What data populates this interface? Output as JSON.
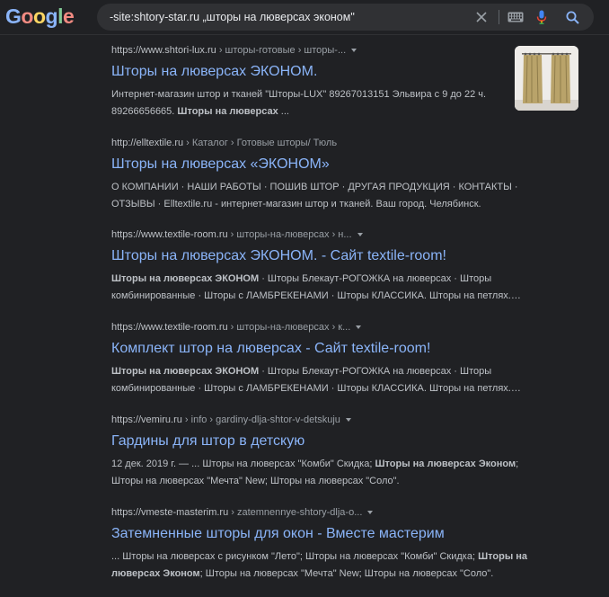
{
  "header": {
    "logo_letters": [
      {
        "ch": "G",
        "color": "#8ab4f8"
      },
      {
        "ch": "o",
        "color": "#f28b82"
      },
      {
        "ch": "o",
        "color": "#fdd663"
      },
      {
        "ch": "g",
        "color": "#8ab4f8"
      },
      {
        "ch": "l",
        "color": "#81c995"
      },
      {
        "ch": "e",
        "color": "#f28b82"
      }
    ],
    "search_query": "-site:shtory-star.ru „шторы на люверсах эконом\""
  },
  "results": [
    {
      "url": "https://www.shtori-lux.ru",
      "crumbs": " › шторы-готовые › шторы-...",
      "title": "Шторы на люверсах ЭКОНОМ.",
      "snippet_parts": [
        {
          "t": "Интернет-магазин штор и тканей \"Шторы-LUX\" 89267013151 Эльвира с 9 до 22 ч. 89266656665. ",
          "b": false
        },
        {
          "t": "Шторы на люверсах",
          "b": true
        },
        {
          "t": " ...",
          "b": false
        }
      ]
    },
    {
      "url": "http://elltextile.ru",
      "crumbs": " › Каталог › Готовые шторы/ Тюль",
      "title": "Шторы на люверсах «ЭКОНОМ»",
      "snippet_parts": [
        {
          "t": "О КОМПАНИИ · НАШИ РАБОТЫ · ПОШИВ ШТОР · ДРУГАЯ ПРОДУКЦИЯ · КОНТАКТЫ · ОТЗЫВЫ · Elltextile.ru - интернет-магазин штор и тканей. Ваш город. Челябинск.",
          "b": false
        }
      ]
    },
    {
      "url": "https://www.textile-room.ru",
      "crumbs": " › шторы-на-люверсах › н...",
      "title": "Шторы на люверсах ЭКОНОМ. - Сайт textile-room!",
      "snippet_parts": [
        {
          "t": "Шторы на люверсах ЭКОНОМ",
          "b": true
        },
        {
          "t": " · Шторы Блекаут-РОГОЖКА на люверсах · Шторы комбинированные · Шторы с ЛАМБРЕКЕНАМИ · Шторы КЛАССИКА. Шторы на петлях.…",
          "b": false
        }
      ]
    },
    {
      "url": "https://www.textile-room.ru",
      "crumbs": " › шторы-на-люверсах › к...",
      "title": "Комплект штор на люверсах - Сайт textile-room!",
      "snippet_parts": [
        {
          "t": "Шторы на люверсах ЭКОНОМ",
          "b": true
        },
        {
          "t": " · Шторы Блекаут-РОГОЖКА на люверсах · Шторы комбинированные · Шторы с ЛАМБРЕКЕНАМИ · Шторы КЛАССИКА. Шторы на петлях.…",
          "b": false
        }
      ]
    },
    {
      "url": "https://vemiru.ru",
      "crumbs": " › info › gardiny-dlja-shtor-v-detskuju",
      "title": "Гардины для штор в детскую",
      "snippet_parts": [
        {
          "t": "12 дек. 2019 г. — ... Шторы на люверсах \"Комби\" Скидка; ",
          "b": false
        },
        {
          "t": "Шторы на люверсах Эконом",
          "b": true
        },
        {
          "t": "; Шторы на люверсах \"Мечта\" New; Шторы на люверсах \"Соло\".",
          "b": false
        }
      ]
    },
    {
      "url": "https://vmeste-masterim.ru",
      "crumbs": " › zatemnennye-shtory-dlja-o...",
      "title": "Затемненные шторы для окон - Вместе мастерим",
      "snippet_parts": [
        {
          "t": "... Шторы на люверсах с рисунком \"Лето\"; Шторы на люверсах \"Комби\" Скидка; ",
          "b": false
        },
        {
          "t": "Шторы на люверсах Эконом",
          "b": true
        },
        {
          "t": "; Шторы на люверсах \"Мечта\" New; Шторы на люверсах \"Соло\".",
          "b": false
        }
      ]
    }
  ]
}
